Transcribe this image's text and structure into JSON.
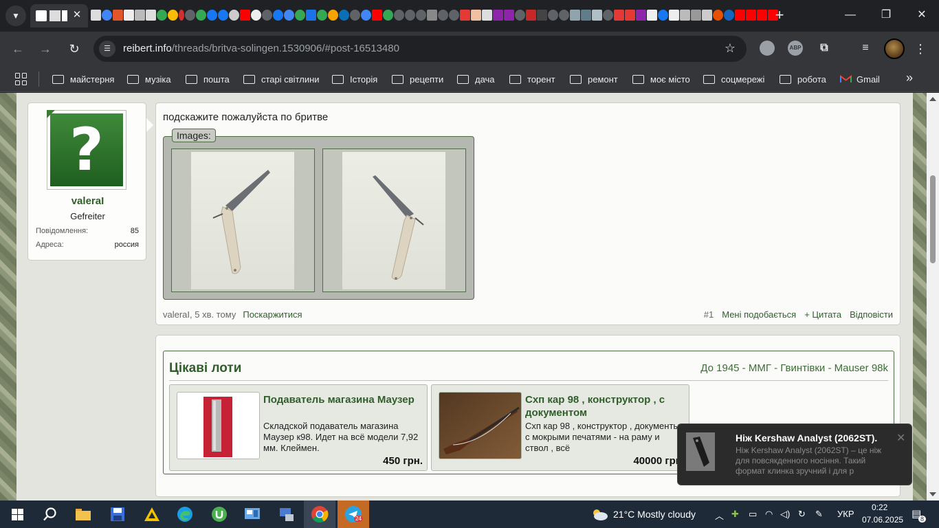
{
  "browser": {
    "url_host": "reibert.info",
    "url_path": "/threads/britva-solingen.1530906/#post-16513480",
    "active_tab_close": "✕",
    "new_tab": "+",
    "ext_abp": "ABP"
  },
  "bookmarks": [
    {
      "label": "майстерня"
    },
    {
      "label": "музіка"
    },
    {
      "label": "пошта"
    },
    {
      "label": "старі світлини"
    },
    {
      "label": "Історія"
    },
    {
      "label": "рецепти"
    },
    {
      "label": "дача"
    },
    {
      "label": "торент"
    },
    {
      "label": "ремонт"
    },
    {
      "label": "моє місто"
    },
    {
      "label": "соцмережі"
    },
    {
      "label": "робота"
    },
    {
      "label": "Gmail"
    }
  ],
  "user": {
    "name": "valeraI",
    "rank": "Gefreiter",
    "messages_label": "Повідомлення:",
    "messages_value": "85",
    "address_label": "Адреса:",
    "address_value": "россия",
    "avatar_glyph": "?"
  },
  "post": {
    "text": "подскажите пожалуйста по бритве",
    "images_legend": "Images:",
    "author_time": "valeraI, 5 хв. тому",
    "report": "Поскаржитися",
    "number": "#1",
    "like": "Мені подобається",
    "quote": "+ Цитата",
    "reply": "Відповісти"
  },
  "lots": {
    "title": "Цікаві лоти",
    "breadcrumb": "До 1945 - ММГ - Гвинтівки - Mauser 98k",
    "items": [
      {
        "name": "Подаватель магазина Маузер",
        "desc": "Складской подаватель магазина Маузер к98. Идет на всё модели 7,92 мм. Клеймен.",
        "price": "450 грн."
      },
      {
        "name": "Схп кар 98 , конструктор , с документом",
        "desc": "Схп кар 98 , конструктор , документы с мокрыми печатями - на раму и ствол , всё",
        "price": "40000 грн."
      }
    ]
  },
  "notification": {
    "title": "Ніж Kershaw Analyst (2062ST).",
    "body": "Ніж Kershaw Analyst (2062ST) – це ніж для повсякденного носіння. Такий формат клинка зручний і для р"
  },
  "taskbar": {
    "weather": "21°C  Mostly cloudy",
    "lang": "УКР",
    "time": "0:22",
    "date": "07.06.2025",
    "telegram_badge": "24",
    "notif_count": "8"
  },
  "colors": {
    "accent_green": "#2f5e2b",
    "chrome_dark": "#202124",
    "chrome_toolbar": "#35363a"
  }
}
